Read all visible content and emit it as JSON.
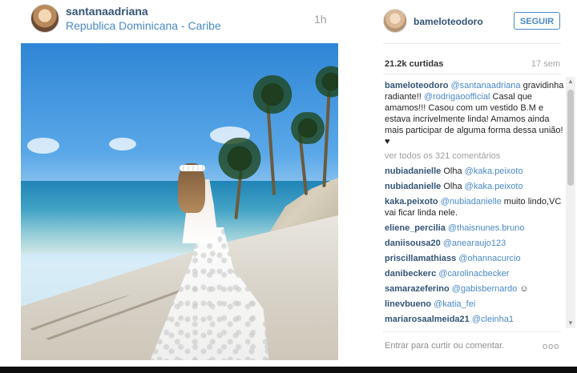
{
  "post": {
    "username": "santanaadriana",
    "location": "Republica Dominicana - Caribe",
    "time": "1h"
  },
  "panel": {
    "username": "bameloteodoro",
    "follow_label": "SEGUIR",
    "likes": "21.2k curtidas",
    "age": "17 sem",
    "caption": {
      "user": "bameloteodoro",
      "mention1": "@santanaadriana",
      "text1": "gravidinha radiante!!",
      "mention2": "@rodrigaoofficial",
      "text2": "Casal que amamos!!! Casou com um vestido B.M e estava incrivelmente linda! Amamos ainda mais participar de alguma forma dessa união! ♥"
    },
    "view_all": "ver todos os 321 comentários",
    "comments": [
      {
        "user": "nubiadanielle",
        "text": "Olha",
        "mention": "@kaka.peixoto",
        "tail": ""
      },
      {
        "user": "nubiadanielle",
        "text": "Olha",
        "mention": "@kaka.peixoto",
        "tail": ""
      },
      {
        "user": "kaka.peixoto",
        "text": "",
        "mention": "@nubiadanielle",
        "tail": "muito lindo,VC vai ficar linda nele."
      },
      {
        "user": "eliene_percilia",
        "text": "",
        "mention": "@thaisnunes.bruno",
        "tail": ""
      },
      {
        "user": "daniisousa20",
        "text": "",
        "mention": "@anearaujo123",
        "tail": ""
      },
      {
        "user": "priscillamathiass",
        "text": "",
        "mention": "@ohannacurcio",
        "tail": ""
      },
      {
        "user": "danibeckerc",
        "text": "",
        "mention": "@carolinacbecker",
        "tail": ""
      },
      {
        "user": "samarazeferino",
        "text": "",
        "mention": "@gabisbernardo",
        "tail": "☺"
      },
      {
        "user": "linevbueno",
        "text": "",
        "mention": "@katia_fei",
        "tail": ""
      },
      {
        "user": "mariarosaalmeida21",
        "text": "",
        "mention": "@cleinha1",
        "tail": ""
      }
    ],
    "comment_placeholder": "Entrar para curtir ou comentar.",
    "options": "ooo"
  },
  "icons": {
    "scroll_up": "scroll-up-arrow-icon",
    "scroll_down": "scroll-down-arrow-icon",
    "options": "more-options-icon"
  },
  "colors": {
    "link": "#4a89c6",
    "username": "#335577"
  }
}
